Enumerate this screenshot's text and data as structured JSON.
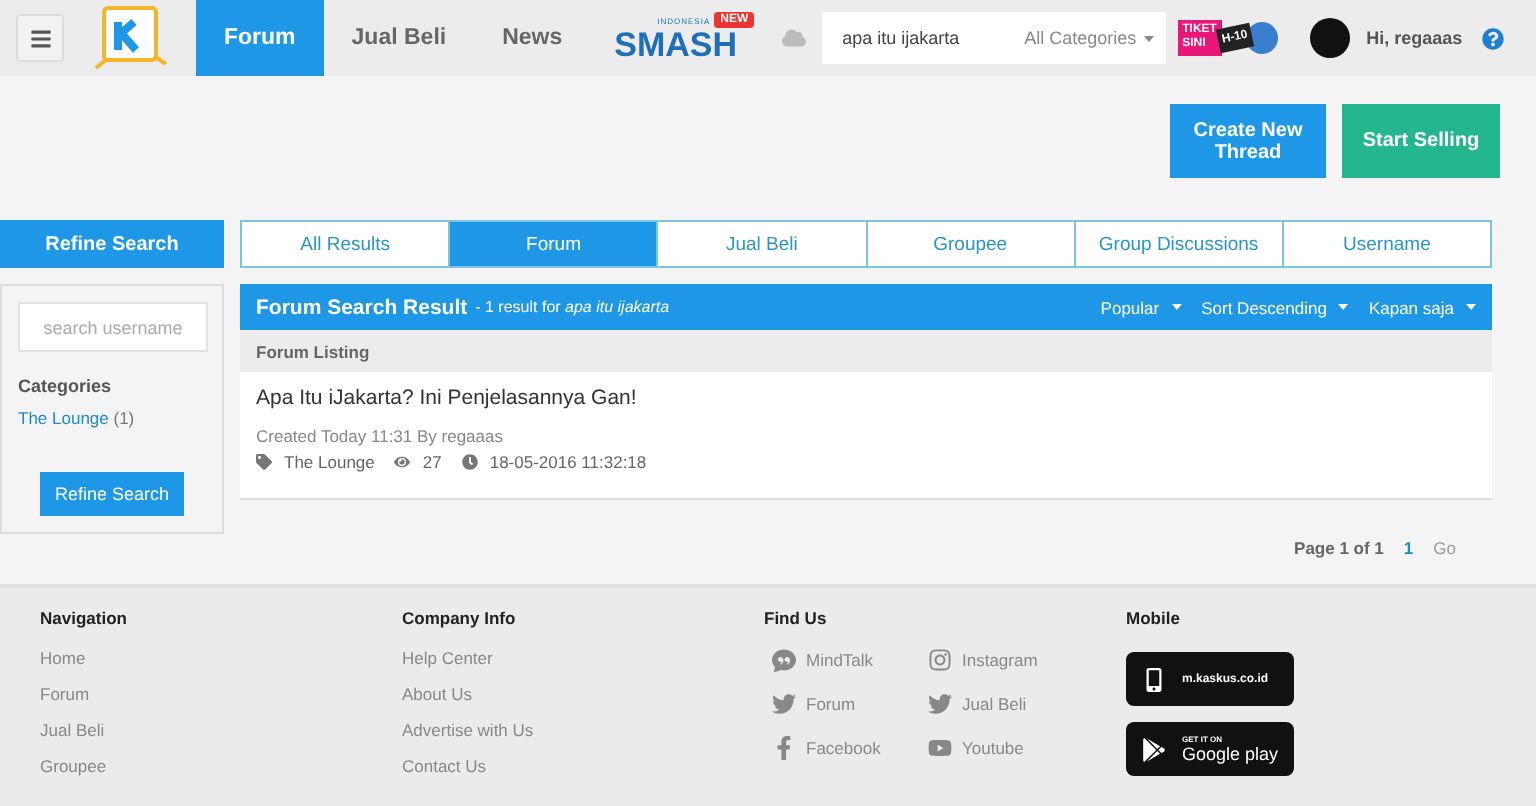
{
  "header": {
    "nav": [
      {
        "label": "Forum",
        "selected": true
      },
      {
        "label": "Jual Beli",
        "selected": false
      },
      {
        "label": "News",
        "selected": false
      }
    ],
    "smash_logo": {
      "top": "INDONESIA",
      "main": "SMASH",
      "badge": "NEW"
    },
    "search": {
      "value": "apa itu ijakarta",
      "category": "All Categories"
    },
    "promo": {
      "text": "TIKET SINI",
      "countdown": "H-10"
    },
    "user": {
      "greeting": "Hi, regaaas"
    }
  },
  "actions": [
    "Create New Thread",
    "Start Selling"
  ],
  "sidebar": {
    "title": "Refine Search",
    "username_placeholder": "search username",
    "categories_label": "Categories",
    "categories": [
      {
        "name": "The Lounge",
        "count": "(1)"
      }
    ],
    "button": "Refine Search"
  },
  "result_tabs": [
    {
      "label": "All Results",
      "selected": false
    },
    {
      "label": "Forum",
      "selected": true
    },
    {
      "label": "Jual Beli",
      "selected": false
    },
    {
      "label": "Groupee",
      "selected": false
    },
    {
      "label": "Group Discussions",
      "selected": false
    },
    {
      "label": "Username",
      "selected": false
    }
  ],
  "results": {
    "title": "Forum Search Result",
    "summary": "- 1 result for *apa itu ijakarta*",
    "sorts": [
      "Popular",
      "Sort Descending",
      "Kapan saja"
    ],
    "listing_label": "Forum Listing",
    "threads": [
      {
        "title": "Apa Itu iJakarta? Ini Penjelasannya Gan!",
        "created": "Created Today 11:31 By regaaas",
        "category": "The Lounge",
        "views": "27",
        "date": "18-05-2016 11:32:18"
      }
    ]
  },
  "pagination": {
    "label": "Page 1 of 1",
    "pages": [
      {
        "label": "1",
        "selected": true
      }
    ],
    "go": "Go"
  },
  "footer": {
    "navigation": {
      "title": "Navigation",
      "links": [
        "Home",
        "Forum",
        "Jual Beli",
        "Groupee"
      ]
    },
    "company": {
      "title": "Company Info",
      "links": [
        "Help Center",
        "About Us",
        "Advertise with Us",
        "Contact Us"
      ]
    },
    "find_us": {
      "title": "Find Us",
      "links": [
        {
          "label": "MindTalk",
          "kind": "mindtalk"
        },
        {
          "label": "Instagram",
          "kind": "instagram"
        },
        {
          "label": "Forum",
          "kind": "twitter"
        },
        {
          "label": "Jual Beli",
          "kind": "twitter"
        },
        {
          "label": "Facebook",
          "kind": "facebook"
        },
        {
          "label": "Youtube",
          "kind": "youtube"
        }
      ]
    },
    "mobile": {
      "title": "Mobile",
      "site": "m.kaskus.co.id",
      "store_small": "GET IT ON",
      "store": "Google play"
    }
  }
}
